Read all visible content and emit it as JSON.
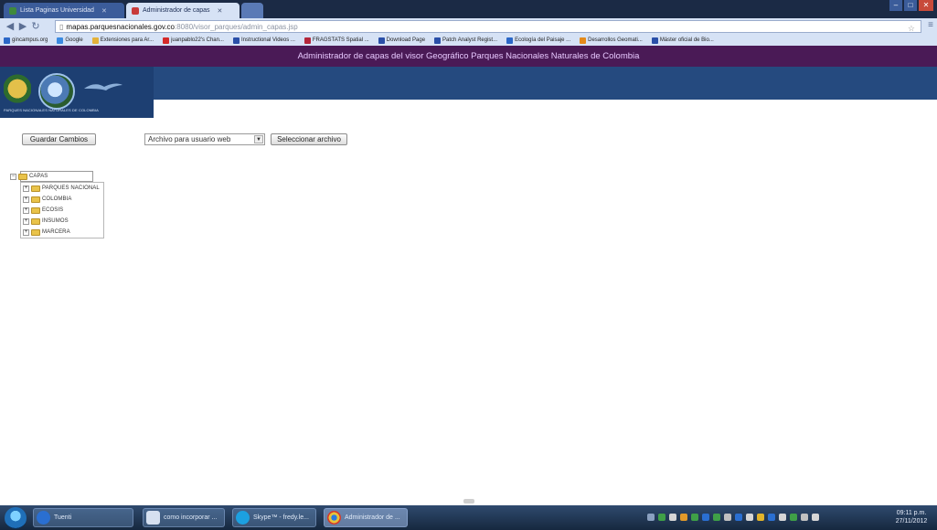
{
  "browser": {
    "tabs": [
      {
        "label": "Lista Paginas Universidad",
        "state": "inactive"
      },
      {
        "label": "Administrador de capas",
        "state": "active"
      },
      {
        "label": "",
        "state": "blank"
      }
    ],
    "url_host": "mapas.parquesnacionales.gov.co",
    "url_path": ":8080/visor_parques/admin_capas.jsp",
    "bookmarks": [
      "gincampus.org",
      "Google",
      "Extensiones para Ar...",
      "juanpablo22's Chan...",
      "Instructional Videos ...",
      "FRAGSTATS Spatial ...",
      "Download Page",
      "Patch Analyst Regist...",
      "Ecología del Paisaje ...",
      "Desarrollos Geomati...",
      "Máster oficial de Bio..."
    ]
  },
  "page": {
    "title": "Administrador de capas del visor Geográfico Parques Nacionales Naturales de Colombia",
    "logo_caption": "PARQUES NACIONALES NATURALES DE COLOMBIA",
    "save_button": "Guardar Cambios",
    "file_select": "Archivo para usuario web",
    "choose_button": "Seleccionar archivo",
    "tree": {
      "root": "CAPAS",
      "children": [
        "PARQUES NACIONAL",
        "COLOMBIA",
        "ECOSIS",
        "INSUMOS",
        "MARCERA"
      ]
    }
  },
  "taskbar": {
    "tasks": [
      "Tuenti",
      "como incorporar ...",
      "Skype™ - fredy.le...",
      "Administrador de ..."
    ],
    "clock_time": "09:11 p.m.",
    "clock_date": "27/11/2012"
  },
  "colors": {
    "title_bar": "#4a1a56",
    "header_band": "#254a7f",
    "tab_strip": "#1b2a45"
  }
}
